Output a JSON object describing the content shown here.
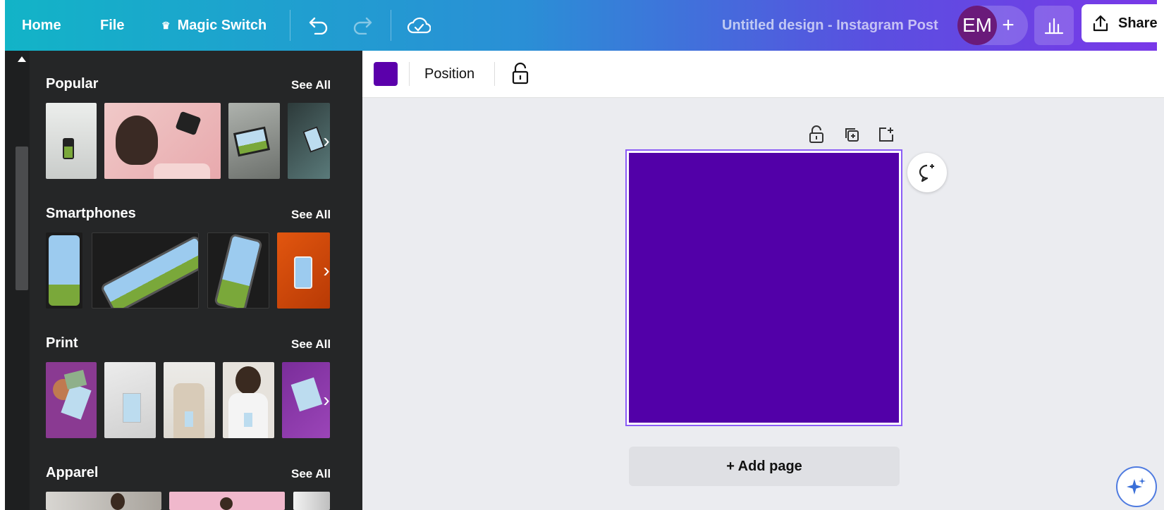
{
  "topbar": {
    "home": "Home",
    "file": "File",
    "magic_switch": "Magic Switch",
    "doc_title": "Untitled design - Instagram Post",
    "avatar_initials": "EM",
    "plus": "+",
    "share": "Share"
  },
  "toolbar": {
    "position": "Position",
    "fill_color": "#5200a8"
  },
  "panel": {
    "sections": [
      {
        "title": "Popular",
        "see_all": "See All"
      },
      {
        "title": "Smartphones",
        "see_all": "See All"
      },
      {
        "title": "Print",
        "see_all": "See All"
      },
      {
        "title": "Apparel",
        "see_all": "See All"
      }
    ]
  },
  "canvas": {
    "add_page": "+ Add page",
    "page_color": "#5200a8"
  },
  "colors": {
    "accent": "#8b5cf6",
    "panel_bg": "#252627",
    "workspace_bg": "#ebecf0"
  }
}
